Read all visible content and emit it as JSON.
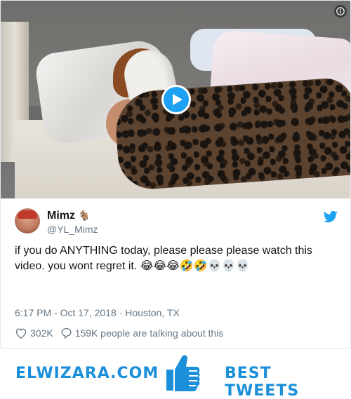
{
  "tweet": {
    "display_name": "Mimz",
    "name_emoji": "🐐",
    "handle": "@YL_Mimz",
    "text": "if you do ANYTHING today, please please please watch this video. you wont regret it. 😂😂😂🤣🤣💀💀💀",
    "timestamp": "6:17 PM - Oct 17, 2018",
    "location_sep": " · ",
    "location": "Houston, TX",
    "likes": "302K",
    "talking": "159K people are talking about this"
  },
  "media": {
    "play_icon": "play-icon",
    "info_icon": "info-icon"
  },
  "banner": {
    "brand": "ELWIZARA.COM",
    "tagline": "BEST TWEETS"
  },
  "colors": {
    "twitter_blue": "#1da1f2",
    "brand_blue": "#1b8fd9",
    "text_primary": "#14171a",
    "text_secondary": "#657786"
  }
}
